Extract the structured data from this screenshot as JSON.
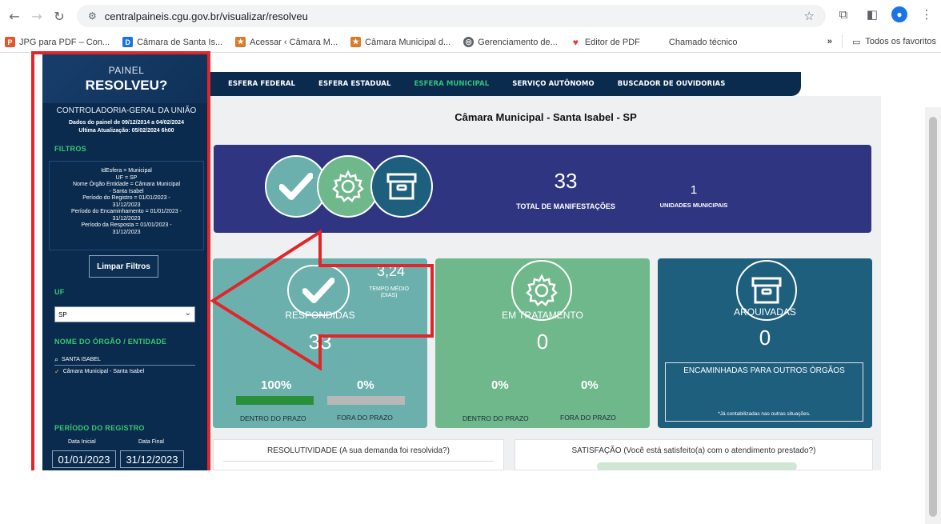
{
  "browser": {
    "url": "centralpaineis.cgu.gov.br/visualizar/resolveu",
    "bookmarks": [
      {
        "label": "JPG para PDF – Con...",
        "icon": "pdf-icon",
        "color": "#e4572e"
      },
      {
        "label": "Câmara de Santa Is...",
        "icon": "d-icon",
        "color": "#1a73e8"
      },
      {
        "label": "Acessar ‹ Câmara M...",
        "icon": "seal-icon",
        "color": "#d97b2a"
      },
      {
        "label": "Câmara Municipal d...",
        "icon": "seal-icon",
        "color": "#d97b2a"
      },
      {
        "label": "Gerenciamento de...",
        "icon": "globe-icon",
        "color": "#5f6368"
      },
      {
        "label": "Editor de PDF",
        "icon": "heart-icon",
        "color": "#e53935"
      },
      {
        "label": "Chamado técnico",
        "icon": "",
        "color": ""
      }
    ],
    "overflow": "»",
    "all_bookmarks": "Todos os favoritos"
  },
  "sidebar": {
    "logo_line1": "PAINEL",
    "logo_line2": "RESOLVEU?",
    "org": "CONTROLADORIA-GERAL DA UNIÃO",
    "dates_line1": "Dados do painel de 09/12/2014 a 04/02/2024",
    "dates_line2": "Ultima Atualização: 05/02/2024 6h00",
    "filters_heading": "FILTROS",
    "filters": [
      "IdEsfera = Municipal",
      "UF = SP",
      "Nome Órgão Entidade = Câmara Municipal",
      "- Santa Isabel",
      "Período do Registro = 01/01/2023 -",
      "31/12/2023",
      "Período do Encaminhamento = 01/01/2023 -",
      "31/12/2023",
      "Período da Resposta = 01/01/2023 -",
      "31/12/2023"
    ],
    "clear_button": "Limpar Filtros",
    "uf_heading": "UF",
    "uf_value": "SP",
    "org_heading": "NOME DO ÓRGÃO / ENTIDADE",
    "org_search": "SANTA ISABEL",
    "org_checked": "Câmara Municipal - Santa Isabel",
    "period_heading": "PERÍODO DO REGISTRO",
    "date_start_label": "Data Inicial",
    "date_end_label": "Data Final",
    "date_start": "01/01/2023",
    "date_end": "31/12/2023"
  },
  "topnav": {
    "items": [
      "ESFERA FEDERAL",
      "ESFERA ESTADUAL",
      "ESFERA MUNICIPAL",
      "SERVIÇO AUTÔNOMO",
      "BUSCADOR DE OUVIDORIAS"
    ],
    "active_index": 2
  },
  "main": {
    "title": "Câmara Municipal  - Santa Isabel - SP",
    "total": "33",
    "total_label": "TOTAL DE MANIFESTAÇÕES",
    "units": "1",
    "units_label": "UNIDADES MUNICIPAIS",
    "cards": {
      "respondidas": {
        "title": "RESPONDIDAS",
        "value": "33",
        "avg_time": "3,24",
        "avg_label": "TEMPO MÉDIO (DIAS)",
        "in_time_pct": "100%",
        "out_time_pct": "0%",
        "in_time_fraction": 1.0,
        "out_time_fraction": 0.0,
        "in_label": "DENTRO DO PRAZO",
        "out_label": "FORA DO PRAZO"
      },
      "tratamento": {
        "title": "EM TRATAMENTO",
        "value": "0",
        "in_time_pct": "0%",
        "out_time_pct": "0%",
        "in_label": "DENTRO DO PRAZO",
        "out_label": "FORA DO PRAZO"
      },
      "arquivadas": {
        "title": "ARQUIVADAS",
        "value": "0",
        "forwarded_label": "ENCAMINHADAS PARA OUTROS ÓRGÃOS",
        "note": "*Já contabilizadas nas outras situações."
      }
    },
    "resolutividade_title": "RESOLUTIVIDADE (A sua demanda foi resolvida?)",
    "satisfacao_title": "SATISFAÇÃO (Você está satisfeito(a) com o atendimento prestado?)"
  },
  "colors": {
    "sidebar": "#0a2b4e",
    "accent_green": "#37c871",
    "banner": "#2f3580",
    "card_teal": "#6bb0ad",
    "card_green": "#6fb88c",
    "card_blue": "#1f5f7e",
    "annotation_red": "#e0262a"
  }
}
